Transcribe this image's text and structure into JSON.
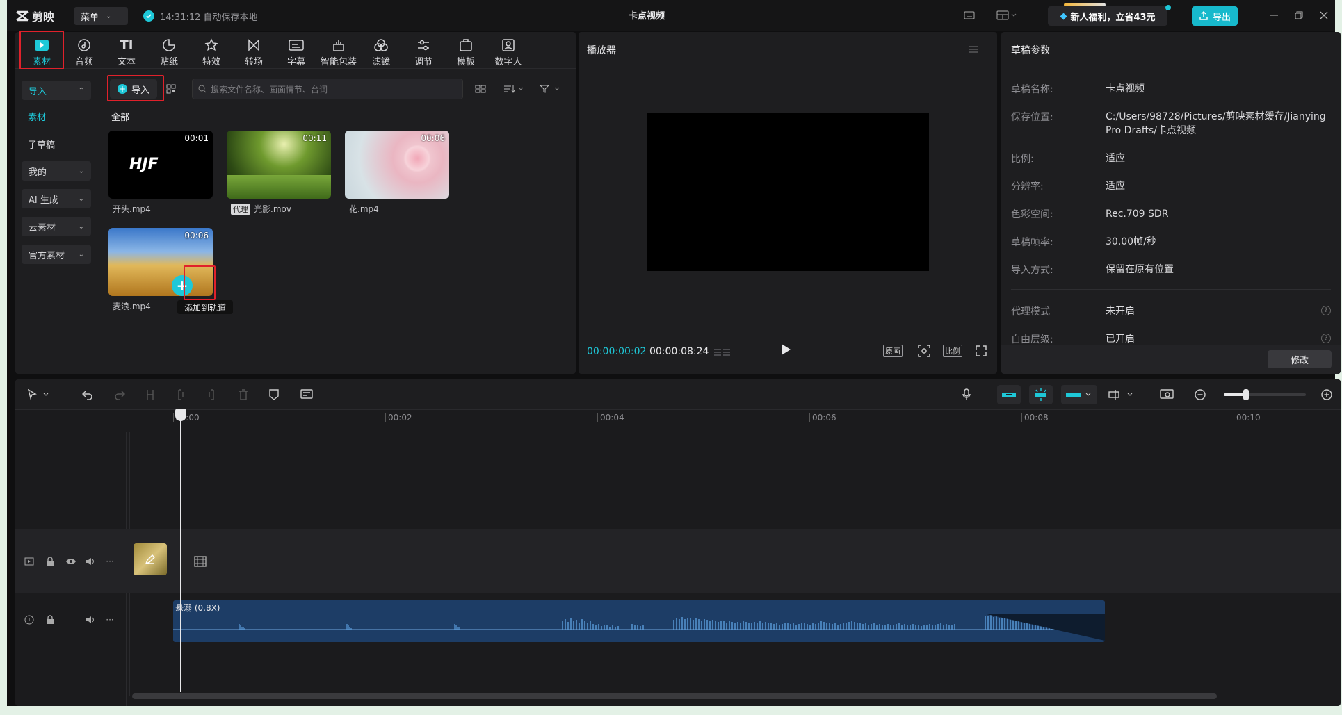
{
  "app": {
    "name": "剪映",
    "title": "卡点视频",
    "menu_label": "菜单",
    "autosave_text": "14:31:12 自动保存本地"
  },
  "header": {
    "promo_label": "新人福利，立省43元",
    "export_label": "导出"
  },
  "toolbar": {
    "tabs": [
      {
        "label": "素材",
        "icon": "media-icon",
        "active": true
      },
      {
        "label": "音频",
        "icon": "audio-icon"
      },
      {
        "label": "文本",
        "icon": "text-icon"
      },
      {
        "label": "贴纸",
        "icon": "sticker-icon"
      },
      {
        "label": "特效",
        "icon": "effects-icon"
      },
      {
        "label": "转场",
        "icon": "transition-icon"
      },
      {
        "label": "字幕",
        "icon": "subtitle-icon"
      },
      {
        "label": "智能包装",
        "icon": "smart-package-icon"
      },
      {
        "label": "滤镜",
        "icon": "filter-icon"
      },
      {
        "label": "调节",
        "icon": "adjust-icon"
      },
      {
        "label": "模板",
        "icon": "template-icon"
      },
      {
        "label": "数字人",
        "icon": "digital-human-icon"
      }
    ]
  },
  "sidebar": {
    "items": [
      {
        "label": "导入",
        "expanded": true
      },
      {
        "label": "素材"
      },
      {
        "label": "子草稿"
      },
      {
        "label": "我的"
      },
      {
        "label": "AI 生成"
      },
      {
        "label": "云素材"
      },
      {
        "label": "官方素材"
      }
    ]
  },
  "media": {
    "import_label": "导入",
    "search_placeholder": "搜索文件名称、画面情节、台词",
    "section_label": "全部",
    "items": [
      {
        "name": "开头.mp4",
        "duration": "00:01",
        "thumb_text": "HJF"
      },
      {
        "name": "光影.mov",
        "duration": "00:11",
        "badge": "代理"
      },
      {
        "name": "花.mp4",
        "duration": "00:06"
      },
      {
        "name": "麦浪.mp4",
        "duration": "00:06"
      }
    ],
    "add_to_track_tooltip": "添加到轨道"
  },
  "player": {
    "title": "播放器",
    "current_time": "00:00:00:02",
    "total_time": "00:00:08:24",
    "original_label": "原画",
    "ratio_label": "比例"
  },
  "draft_params": {
    "title": "草稿参数",
    "rows": [
      {
        "label": "草稿名称:",
        "value": "卡点视频"
      },
      {
        "label": "保存位置:",
        "value": "C:/Users/98728/Pictures/剪映素材缓存/JianyingPro Drafts/卡点视频"
      },
      {
        "label": "比例:",
        "value": "适应"
      },
      {
        "label": "分辨率:",
        "value": "适应"
      },
      {
        "label": "色彩空间:",
        "value": "Rec.709 SDR"
      },
      {
        "label": "草稿帧率:",
        "value": "30.00帧/秒"
      },
      {
        "label": "导入方式:",
        "value": "保留在原有位置"
      },
      {
        "label": "代理模式",
        "value": "未开启"
      },
      {
        "label": "自由层级:",
        "value": "已开启"
      }
    ],
    "modify_label": "修改"
  },
  "timeline": {
    "ruler": [
      "00:00",
      "00:02",
      "00:04",
      "00:06",
      "00:08",
      "00:10"
    ],
    "audio_clip_label": "悬溺 (0.8X)"
  },
  "colors": {
    "accent": "#1ec8d8",
    "highlight": "#e0212b",
    "audio_clip": "#1d3d66"
  }
}
